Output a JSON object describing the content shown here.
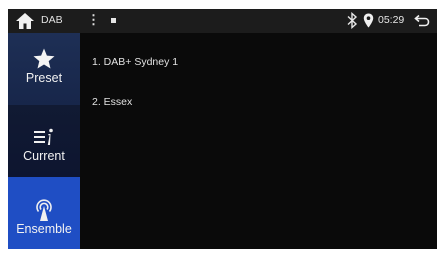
{
  "status_bar": {
    "source": "DAB",
    "time": "05:29",
    "icons": [
      "home-icon",
      "more-vert-icon",
      "square-indicator-icon",
      "bluetooth-icon",
      "location-icon",
      "back-icon"
    ]
  },
  "sidebar": {
    "tabs": [
      {
        "label": "Preset",
        "icon": "star-icon",
        "selected": false
      },
      {
        "label": "Current",
        "icon": "station-info-icon",
        "selected": false
      },
      {
        "label": "Ensemble",
        "icon": "antenna-icon",
        "selected": true
      }
    ]
  },
  "ensemble_list": [
    "1. DAB+ Sydney 1",
    "2. Essex"
  ],
  "colors": {
    "accent_selected": "#1f4ec4",
    "background": "#0a0a0a"
  }
}
